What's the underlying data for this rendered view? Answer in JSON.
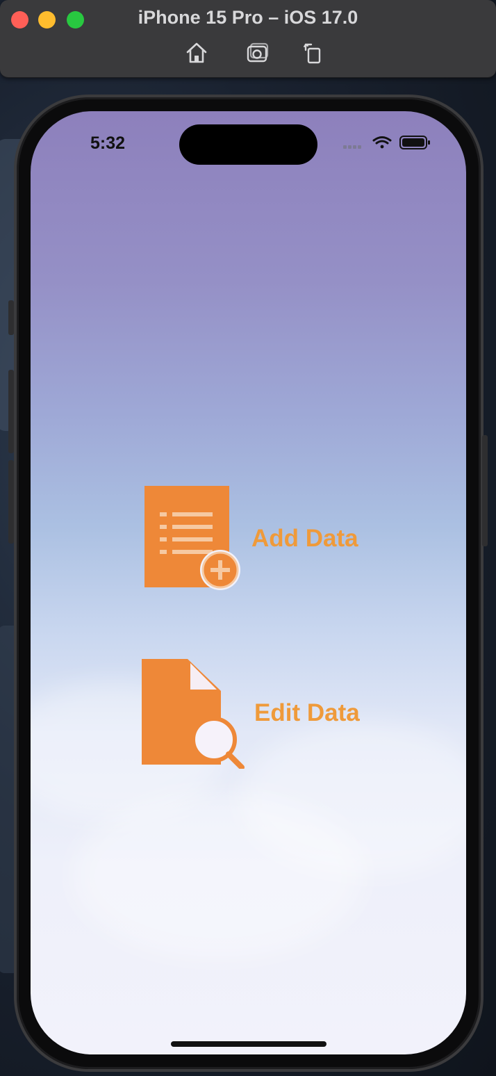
{
  "window": {
    "title": "iPhone 15 Pro – iOS 17.0",
    "toolbar": {
      "home_icon": "home-icon",
      "screenshot_icon": "camera-icon",
      "rotate_icon": "rotate-icon"
    }
  },
  "status_bar": {
    "time": "5:32",
    "icons": [
      "signal-icon",
      "wifi-icon",
      "battery-icon"
    ]
  },
  "actions": [
    {
      "label": "Add Data",
      "icon": "document-add-icon"
    },
    {
      "label": "Edit Data",
      "icon": "document-search-icon"
    }
  ],
  "colors": {
    "accent": "#ef9a3a",
    "icon_fill": "#ee8838"
  }
}
